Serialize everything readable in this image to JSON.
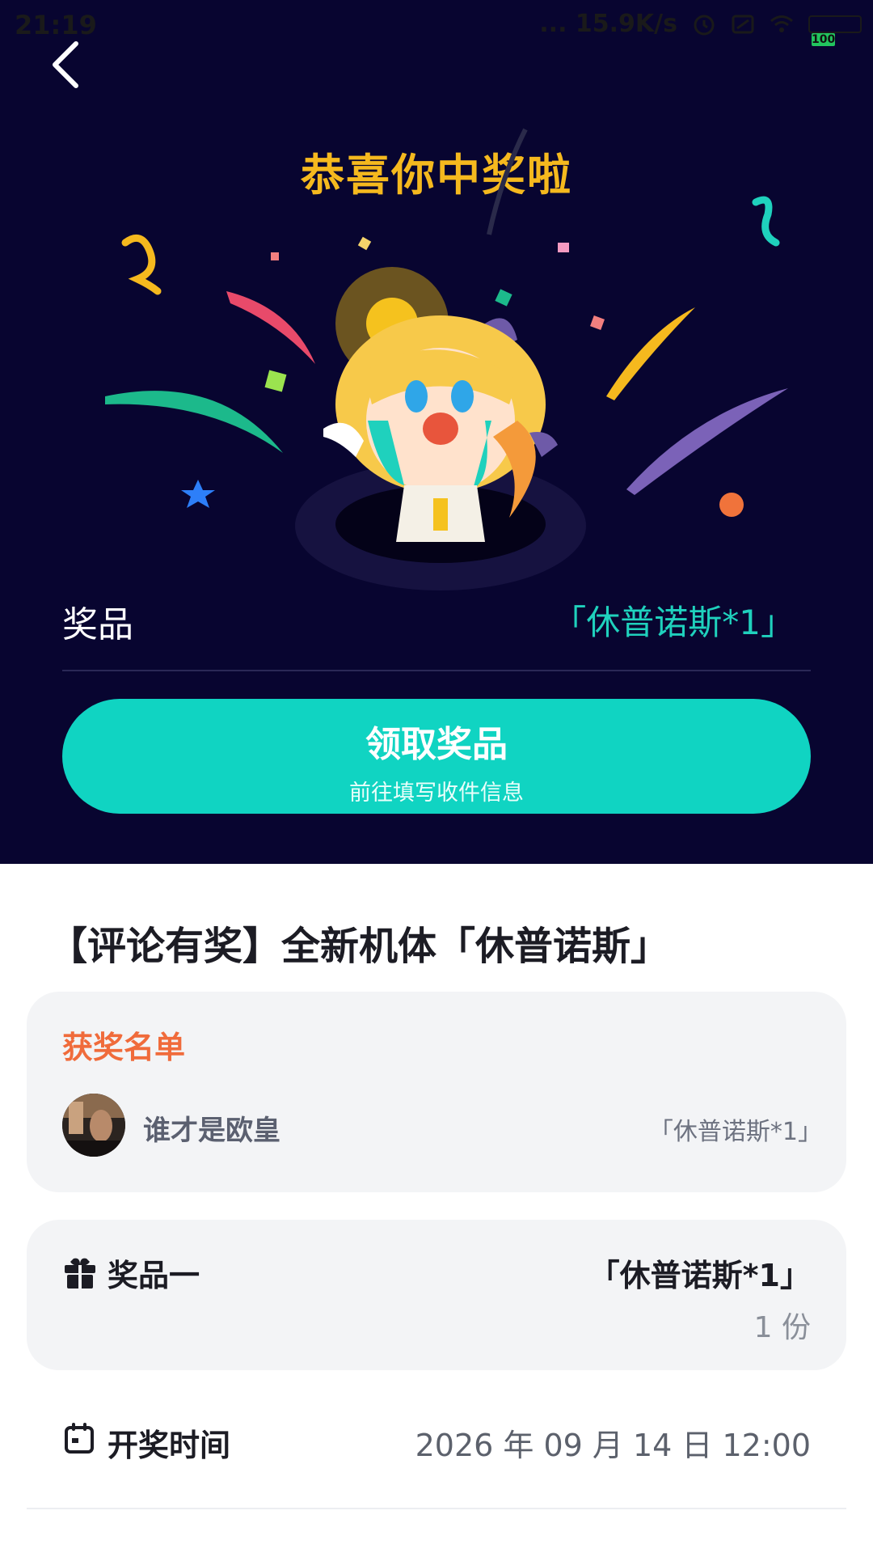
{
  "status_bar": {
    "time": "21:19",
    "net_speed": "... 15.9K/s",
    "battery": "100"
  },
  "hero": {
    "title": "恭喜你中奖啦",
    "prize_label": "奖品",
    "prize_value": "「休普诺斯*1」",
    "claim_button": {
      "label": "领取奖品",
      "sub": "前往填写收件信息"
    }
  },
  "event": {
    "title": "【评论有奖】全新机体「休普诺斯」"
  },
  "winners": {
    "title": "获奖名单",
    "list": [
      {
        "name": "谁才是欧皇",
        "prize": "「休普诺斯*1」"
      }
    ]
  },
  "prize_info": {
    "label": "奖品一",
    "value": "「休普诺斯*1」",
    "count": "1 份"
  },
  "draw_info": {
    "label": "开奖时间",
    "time": "2026 年 09 月 14 日 12:00"
  },
  "colors": {
    "hero_bg": "#080530",
    "accent_teal": "#10d4c2",
    "title_gold": "#f5b91e",
    "winner_orange": "#f06b3b"
  },
  "icons": [
    "back-arrow-icon",
    "gift-icon",
    "calendar-icon",
    "wifi-icon",
    "alarm-icon",
    "battery-icon"
  ]
}
